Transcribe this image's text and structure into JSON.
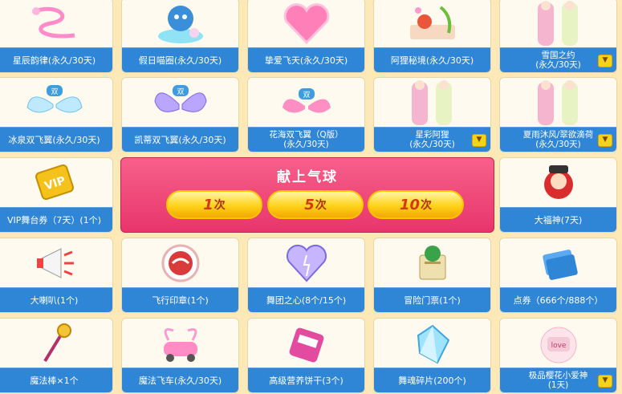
{
  "rows": [
    [
      {
        "label": "星辰韵律(永久/30天)",
        "icon": "pink-ribbon-icon",
        "expand": false
      },
      {
        "label": "假日喵圈(永久/30天)",
        "icon": "cat-ring-icon",
        "expand": false
      },
      {
        "label": "挚爱飞天(永久/30天)",
        "icon": "heart-wings-icon",
        "expand": false
      },
      {
        "label": "阿狸秘境(永久/30天)",
        "icon": "fox-garden-icon",
        "expand": false
      },
      {
        "label": "雪国之约\n(永久/30天)",
        "icon": "outfit-icon",
        "expand": true
      }
    ],
    [
      {
        "label": "冰泉双飞翼(永久/30天)",
        "icon": "ice-wings-icon",
        "expand": false
      },
      {
        "label": "凯蒂双飞翼(永久/30天)",
        "icon": "butterfly-wings-icon",
        "expand": false
      },
      {
        "label": "花海双飞翼（Q版）\n(永久/30天)",
        "icon": "flower-wings-icon",
        "expand": false
      },
      {
        "label": "星彩阿狸\n(永久/30天)",
        "icon": "outfit-icon",
        "expand": true
      },
      {
        "label": "夏雨沐风/翠欲滴荷\n(永久/30天)",
        "icon": "outfit-icon",
        "expand": true
      }
    ],
    [
      {
        "label": "VIP舞台券（7天）(1个)",
        "icon": "vip-ticket-icon",
        "expand": false
      },
      null,
      null,
      null,
      {
        "label": "大福神(7天)",
        "icon": "fortune-god-icon",
        "expand": false
      }
    ],
    [
      {
        "label": "大喇叭(1个)",
        "icon": "megaphone-icon",
        "expand": false
      },
      {
        "label": "飞行印章(1个)",
        "icon": "flying-stamp-icon",
        "expand": false
      },
      {
        "label": "舞团之心(8个/15个)",
        "icon": "crystal-heart-icon",
        "expand": false
      },
      {
        "label": "冒险门票(1个)",
        "icon": "adventure-ticket-icon",
        "expand": false
      },
      {
        "label": "点券（666个/888个）",
        "icon": "coupon-icon",
        "expand": false
      }
    ],
    [
      {
        "label": "魔法棒×1个",
        "icon": "magic-wand-icon",
        "expand": false
      },
      {
        "label": "魔法飞车(永久/30天)",
        "icon": "magic-car-icon",
        "expand": false
      },
      {
        "label": "高级营养饼干(3个)",
        "icon": "biscuit-icon",
        "expand": false
      },
      {
        "label": "舞魂碎片(200个)",
        "icon": "crystal-shard-icon",
        "expand": false
      },
      {
        "label": "极品樱花小爱神\n(1天)",
        "icon": "cupid-icon",
        "expand": true
      }
    ]
  ],
  "banner": {
    "title": "献上气球",
    "buttons": [
      {
        "count": "1",
        "unit": "次"
      },
      {
        "count": "5",
        "unit": "次"
      },
      {
        "count": "10",
        "unit": "次"
      }
    ]
  },
  "colors": {
    "background": "#fde9b8",
    "label_bar": "#2f86d6",
    "banner": "#e8356b",
    "button": "#ffd21a",
    "button_text": "#d23a14"
  }
}
